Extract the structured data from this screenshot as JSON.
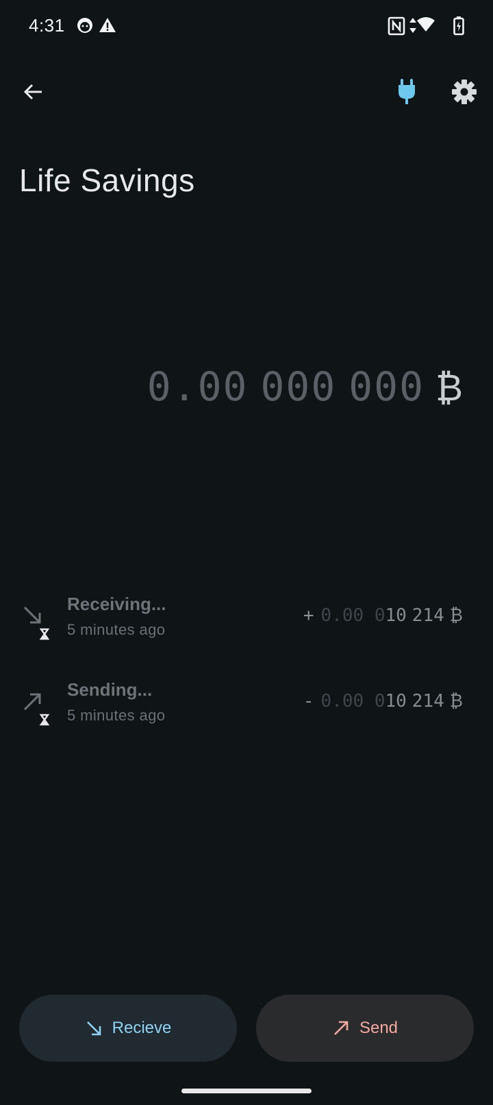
{
  "status_bar": {
    "time": "4:31",
    "icons": [
      "account-face-icon",
      "warning-icon",
      "nfc-icon",
      "data-arrows-icon",
      "wifi-icon",
      "battery-charging-icon"
    ]
  },
  "top_bar": {
    "back_icon": "arrow-left-icon",
    "plug_icon": "plug-icon",
    "settings_icon": "gear-icon",
    "accent": "#6ec8ee"
  },
  "wallet": {
    "title": "Life Savings",
    "balance": {
      "int": "0.",
      "g1": "00",
      "g2": "000",
      "g3": "000",
      "unit": "₿"
    }
  },
  "transactions": [
    {
      "title": "Receiving...",
      "time": "5 minutes ago",
      "direction_icon": "arrow-down-right-icon",
      "pending_icon": "hourglass-icon",
      "sign": "+",
      "amount_dim": "0.00 0",
      "amount_lit_a": "10",
      "amount_lit_b": "214",
      "unit": "₿"
    },
    {
      "title": "Sending...",
      "time": "5 minutes ago",
      "direction_icon": "arrow-up-right-icon",
      "pending_icon": "hourglass-icon",
      "sign": "-",
      "amount_dim": "0.00 0",
      "amount_lit_a": "10",
      "amount_lit_b": "214",
      "unit": "₿"
    }
  ],
  "actions": {
    "receive_label": "Recieve",
    "send_label": "Send",
    "receive_color": "#8fd1f3",
    "send_color": "#f4a9a0"
  }
}
